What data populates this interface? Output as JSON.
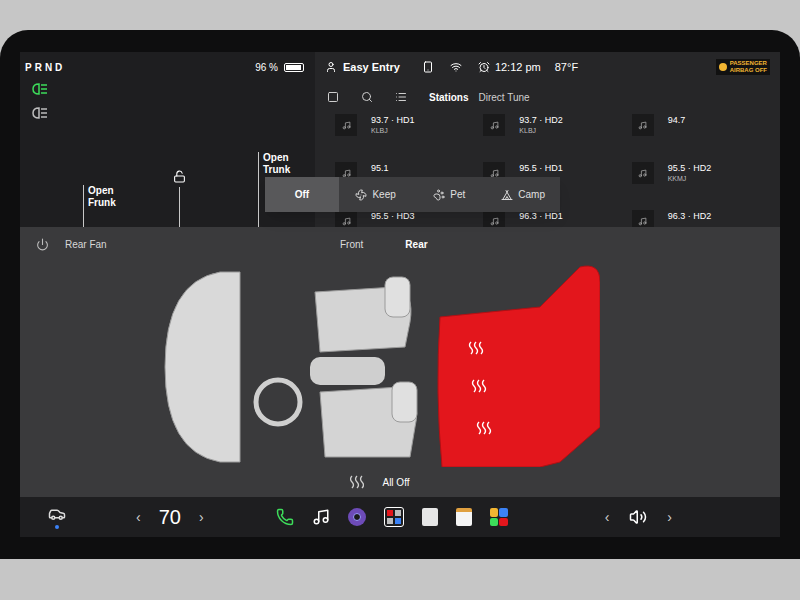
{
  "status": {
    "gear": "PRND",
    "battery": "96 %",
    "battery_level": 0.96,
    "profile": "Easy Entry",
    "time": "12:12 pm",
    "temperature": "87°F",
    "airbag_badge": [
      "PASSENGER",
      "AIRBAG OFF"
    ]
  },
  "lights": [
    {
      "name": "headlights",
      "on": true
    },
    {
      "name": "parking-lights",
      "on": false
    }
  ],
  "vehicle_controls": {
    "frunk": "Open Frunk",
    "trunk": "Open Trunk",
    "locked": false
  },
  "media": {
    "tabs": [
      {
        "label": "Stations",
        "selected": true
      },
      {
        "label": "Direct Tune",
        "selected": false
      }
    ],
    "stations": [
      {
        "frequency": "93.7 · HD1",
        "call_sign": "KLBJ"
      },
      {
        "frequency": "93.7 · HD2",
        "call_sign": "KLBJ"
      },
      {
        "frequency": "94.7",
        "call_sign": ""
      },
      {
        "frequency": "95.1",
        "call_sign": ""
      },
      {
        "frequency": "95.5 · HD1",
        "call_sign": ""
      },
      {
        "frequency": "95.5 · HD2",
        "call_sign": "KKMJ"
      },
      {
        "frequency": "95.5 · HD3",
        "call_sign": ""
      },
      {
        "frequency": "96.3 · HD1",
        "call_sign": ""
      },
      {
        "frequency": "96.3 · HD2",
        "call_sign": ""
      }
    ]
  },
  "climate_keep": [
    {
      "label": "Off",
      "kind": "off",
      "selected": true
    },
    {
      "label": "Keep",
      "kind": "keep",
      "selected": false
    },
    {
      "label": "Pet",
      "kind": "pet",
      "selected": false
    },
    {
      "label": "Camp",
      "kind": "camp",
      "selected": false
    }
  ],
  "seat_heater": {
    "rear_fan": {
      "label": "Rear Fan",
      "on": false
    },
    "tabs": [
      {
        "label": "Front",
        "selected": false
      },
      {
        "label": "Rear",
        "selected": true
      }
    ],
    "front_seats": [
      {
        "heat": 0
      },
      {
        "heat": 0
      }
    ],
    "rear_seats": [
      {
        "heat": 3
      },
      {
        "heat": 3
      },
      {
        "heat": 3
      }
    ],
    "all_off": "All Off"
  },
  "bottom_bar": {
    "temperature": "70",
    "temp_down": "‹",
    "temp_up": "›",
    "volume_down": "‹",
    "volume_up": "›"
  }
}
